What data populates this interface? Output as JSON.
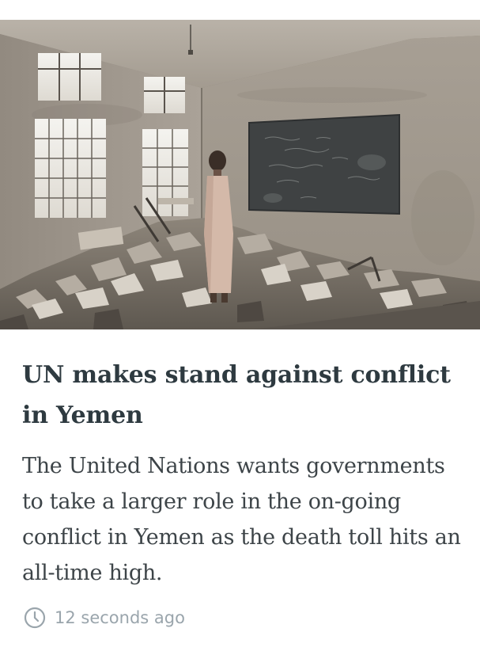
{
  "article": {
    "image_alt": "A boy stands amid the rubble of a destroyed classroom",
    "headline": "UN makes stand against conflict in Yemen",
    "summary": "The United Nations wants governments to take a larger role in the on-going conflict in Yemen as the death toll hits an all-time high.",
    "timestamp": "12 seconds ago",
    "timestamp_icon": "clock-icon"
  },
  "colors": {
    "headline": "#2e3a40",
    "summary": "#3d4448",
    "timestamp": "#9aa5ac",
    "background": "#ffffff"
  }
}
